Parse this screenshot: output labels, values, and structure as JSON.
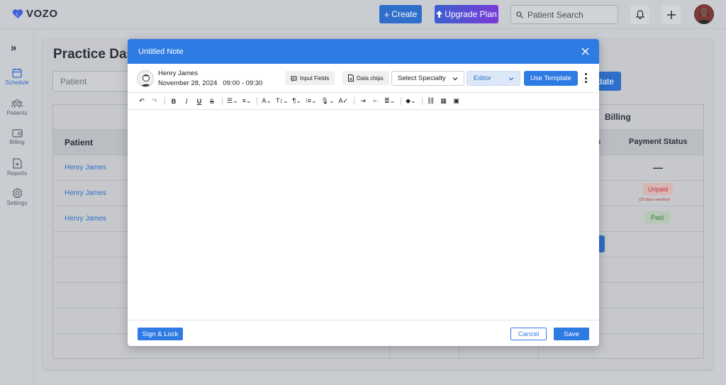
{
  "app": {
    "logo_text": "VOZO"
  },
  "header": {
    "create_label": "Create",
    "upgrade_label": "Upgrade Plan",
    "search_placeholder": "Patient Search"
  },
  "sidebar": {
    "items": [
      {
        "label": "Schedule",
        "icon": "calendar-icon",
        "active": true
      },
      {
        "label": "Patients",
        "icon": "users-icon",
        "active": false
      },
      {
        "label": "Billing",
        "icon": "wallet-icon",
        "active": false
      },
      {
        "label": "Reports",
        "icon": "report-icon",
        "active": false
      },
      {
        "label": "Settings",
        "icon": "gear-icon",
        "active": false
      }
    ]
  },
  "dashboard": {
    "title": "Practice Das",
    "patient_placeholder": "Patient",
    "update_label": "date",
    "billing_header": "Billing",
    "patient_col": "Patient",
    "details_col_fragment": "ils",
    "payment_status_col": "Payment Status",
    "rows": [
      {
        "patient": "Henry James",
        "payment": "—"
      },
      {
        "patient": "Henry James",
        "payment": "Unpaid",
        "note": "(20 days overdue)"
      },
      {
        "patient": "Henry James",
        "payment": "Paid"
      }
    ]
  },
  "modal": {
    "title": "Untitled Note",
    "patient_name": "Henry James",
    "date": "November 28, 2024",
    "time": "09:00 - 09:30",
    "input_fields_label": "Input Fields",
    "data_chips_label": "Data chips",
    "specialty_value": "Select Specialty",
    "editor_value": "Editor",
    "use_template_label": "Use Template",
    "sign_lock_label": "Sign & Lock",
    "cancel_label": "Cancel",
    "save_label": "Save"
  },
  "colors": {
    "primary": "#2f7be4",
    "unpaid": "#c13838",
    "paid": "#3a7a42"
  }
}
